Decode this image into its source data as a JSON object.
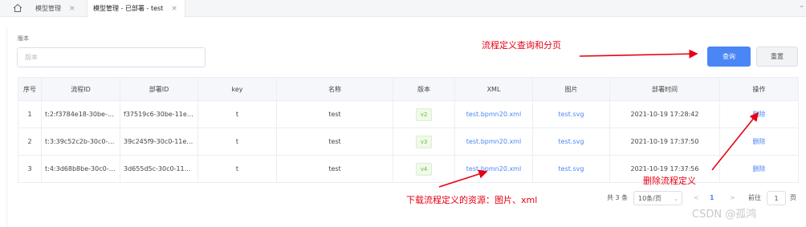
{
  "tabs": {
    "items": [
      {
        "label": "模型管理",
        "close": "×"
      },
      {
        "label": "模型管理 - 已部署 - test",
        "close": "×"
      }
    ],
    "more": "⌄"
  },
  "search": {
    "label": "版本",
    "placeholder": "版本"
  },
  "buttons": {
    "query": "查询",
    "reset": "重置"
  },
  "table": {
    "headers": [
      "序号",
      "流程ID",
      "部署ID",
      "key",
      "名称",
      "版本",
      "XML",
      "图片",
      "部署时间",
      "操作"
    ],
    "rows": [
      {
        "index": "1",
        "process_id": "t:2:f3784e18-30be-11...",
        "deploy_id": "f37519c6-30be-11ec...",
        "key": "t",
        "name": "test",
        "version": "v2",
        "xml": "test.bpmn20.xml",
        "image": "test.svg",
        "time": "2021-10-19 17:28:42",
        "action": "删除"
      },
      {
        "index": "2",
        "process_id": "t:3:39c52c2b-30c0-11...",
        "deploy_id": "39c245f9-30c0-11ec...",
        "key": "t",
        "name": "test",
        "version": "v3",
        "xml": "test.bpmn20.xml",
        "image": "test.svg",
        "time": "2021-10-19 17:37:50",
        "action": "删除"
      },
      {
        "index": "3",
        "process_id": "t:4:3d68b8be-30c0-1...",
        "deploy_id": "3d655d5c-30c0-11e...",
        "key": "t",
        "name": "test",
        "version": "v4",
        "xml": "test.bpmn20.xml",
        "image": "test.svg",
        "time": "2021-10-19 17:37:56",
        "action": "删除"
      }
    ]
  },
  "pagination": {
    "total": "共 3 条",
    "page_size": "10条/页",
    "prev": "<",
    "current": "1",
    "next": ">",
    "goto_label": "前往",
    "goto_value": "1",
    "goto_unit": "页"
  },
  "annotations": {
    "query_paging": "流程定义查询和分页",
    "delete_def": "删除流程定义",
    "download": "下载流程定义的资源：图片、xml"
  },
  "watermark": "CSDN @孤鸿",
  "colors": {
    "primary": "#4a86f5",
    "annotation": "#e60012",
    "tag_green": "#67c23a"
  }
}
